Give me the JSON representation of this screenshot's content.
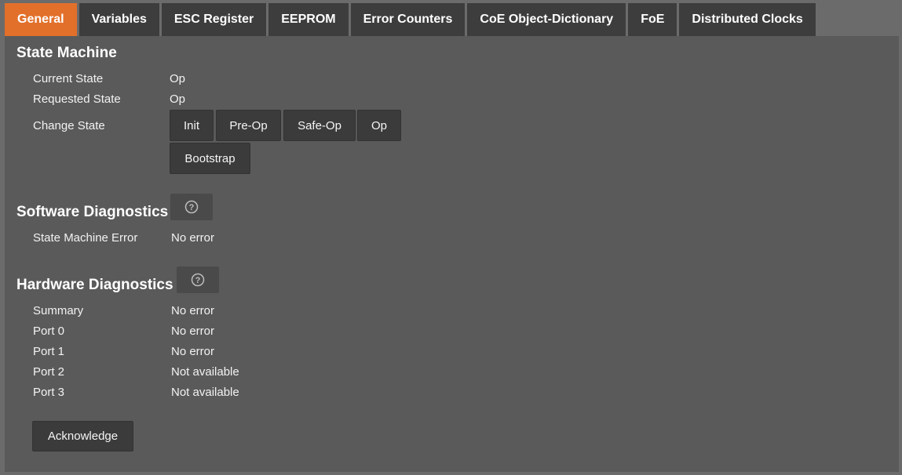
{
  "tabs": [
    {
      "label": "General",
      "active": true
    },
    {
      "label": "Variables"
    },
    {
      "label": "ESC Register"
    },
    {
      "label": "EEPROM"
    },
    {
      "label": "Error Counters"
    },
    {
      "label": "CoE Object-Dictionary"
    },
    {
      "label": "FoE"
    },
    {
      "label": "Distributed Clocks"
    }
  ],
  "state_machine": {
    "title": "State Machine",
    "current_state_label": "Current State",
    "current_state_value": "Op",
    "requested_state_label": "Requested State",
    "requested_state_value": "Op",
    "change_state_label": "Change State",
    "buttons": {
      "init": "Init",
      "pre_op": "Pre-Op",
      "safe_op": "Safe-Op",
      "op": "Op",
      "bootstrap": "Bootstrap"
    }
  },
  "software_diagnostics": {
    "title": "Software Diagnostics",
    "help_icon": "question-circle-icon",
    "state_machine_error_label": "State Machine Error",
    "state_machine_error_value": "No error"
  },
  "hardware_diagnostics": {
    "title": "Hardware Diagnostics",
    "help_icon": "question-circle-icon",
    "rows": [
      {
        "label": "Summary",
        "value": "No error"
      },
      {
        "label": "Port 0",
        "value": "No error"
      },
      {
        "label": "Port 1",
        "value": "No error"
      },
      {
        "label": "Port 2",
        "value": "Not available"
      },
      {
        "label": "Port 3",
        "value": "Not available"
      }
    ],
    "acknowledge_label": "Acknowledge"
  },
  "colors": {
    "accent": "#e2702a",
    "tab_bg": "#3d3d3d",
    "panel_bg": "#5a5a5a",
    "page_bg": "#6b6b6b"
  }
}
